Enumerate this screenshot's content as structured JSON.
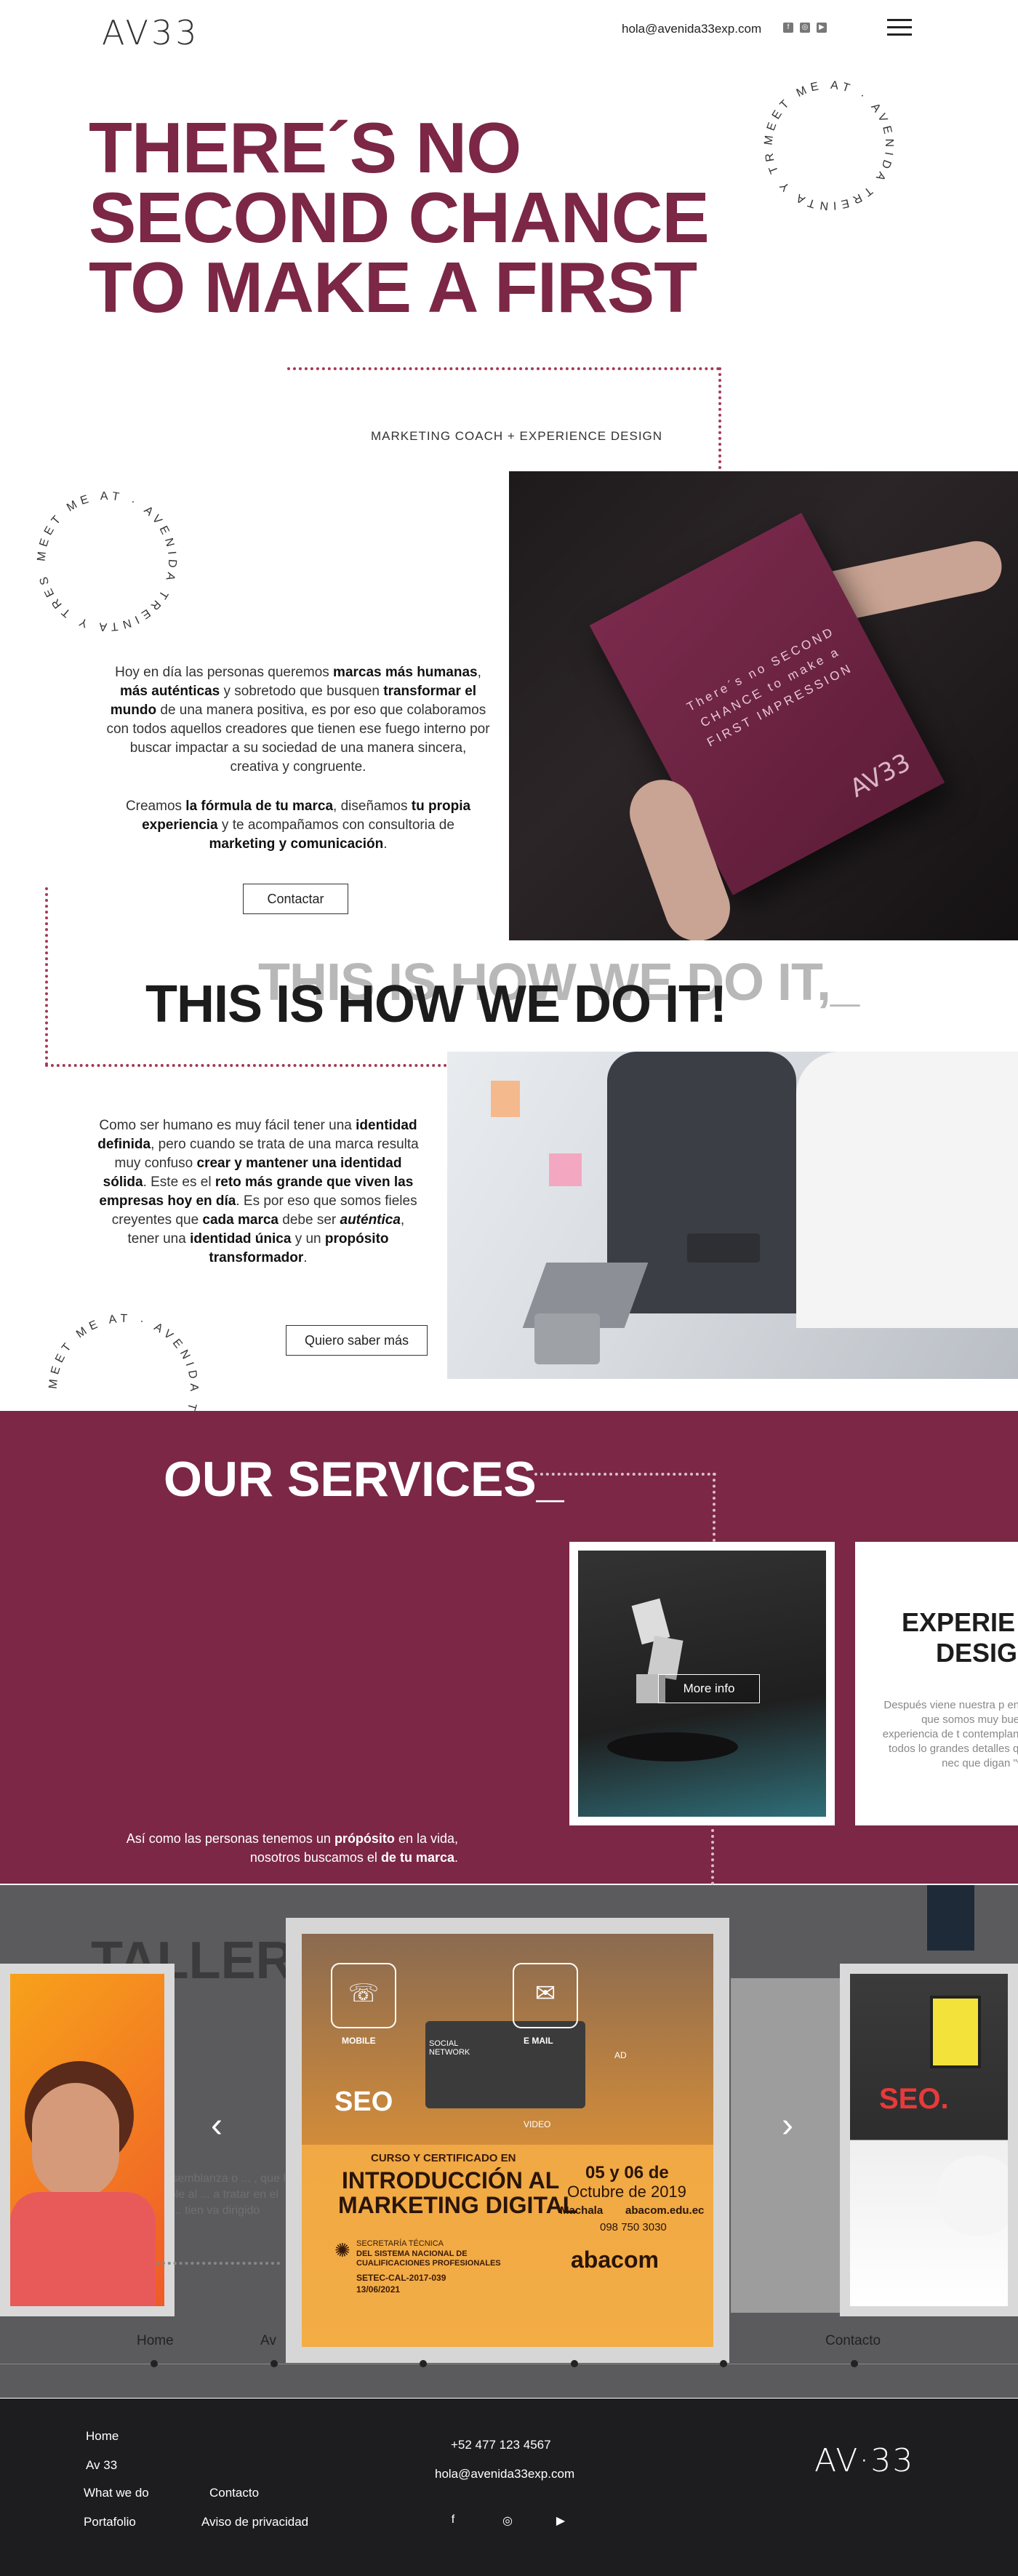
{
  "header": {
    "logo": "AV33",
    "email": "hola@avenida33exp.com",
    "social_icons": [
      "facebook-icon",
      "instagram-icon",
      "youtube-icon"
    ]
  },
  "hero": {
    "title": "THERE´S NO SECOND CHANCE TO MAKE A FIRST",
    "subtitle": "MARKETING COACH + EXPERIENCE DESIGN",
    "ring_text": "MEET ME AT · AVENIDA TREINTA Y TRES ·"
  },
  "about": {
    "ring_text": "MEET ME AT · AVENIDA TREINTA Y TRES ·",
    "para1_a": "Hoy en día las personas queremos ",
    "para1_b": "marcas más humanas",
    "para1_c": ", ",
    "para1_d": "más auténticas",
    "para1_e": " y sobretodo que busquen ",
    "para1_f": "transformar el mundo",
    "para1_g": " de una manera positiva, es por eso que colaboramos con todos aquellos creadores que tienen ese fuego interno por buscar impactar a su sociedad de una manera sincera, creativa y congruente.",
    "para2_a": "Creamos ",
    "para2_b": "la fórmula de tu marca",
    "para2_c": ", diseñamos ",
    "para2_d": "tu propia experiencia",
    "para2_e": " y te acompañamos con consultoria de ",
    "para2_f": "marketing y comunicación",
    "para2_g": ".",
    "button": "Contactar",
    "book_text": "There´s no SECOND CHANCE to make a FIRST IMPRESSION",
    "book_logo": "AV33"
  },
  "how": {
    "shadow_title": "THIS IS HOW WE DO IT,_",
    "title": "THIS IS HOW WE DO IT!",
    "p_a": "Como ser humano es muy fácil tener una ",
    "p_b": "identidad definida",
    "p_c": ", pero cuando se trata de una marca resulta muy confuso ",
    "p_d": "crear y mantener una identidad sólida",
    "p_e": ". Este es el ",
    "p_f": "reto más grande que viven las empresas hoy en día",
    "p_g": ". Es por eso que somos fieles creyentes que ",
    "p_h": "cada marca",
    "p_i": " debe ser ",
    "p_j": "auténtica",
    "p_k": ", tener una ",
    "p_l": "identidad única",
    "p_m": " y un ",
    "p_n": "propósito transformador",
    "p_o": ".",
    "button": "Quiero saber más",
    "ring_text": "MEET ME AT · AVENIDA TREINTA Y TRES ·"
  },
  "services": {
    "title": "OUR SERVICES_",
    "card_button": "More info",
    "card2_title_1": "EXPERIE",
    "card2_title_2": "DESIG",
    "card2_text": "Después viene nuestra p en lo que somos muy bue la experiencia de t contemplando todos lo grandes detalles que nec que digan \"wo",
    "foot_a": "Así como las personas tenemos un ",
    "foot_b": "própósito",
    "foot_c": " en la vida, nosotros buscamos el ",
    "foot_d": "de tu marca",
    "foot_e": "."
  },
  "talleres": {
    "title": "TALLERE",
    "bg_text": "ve semblanza o ... , que le hable al ... a tratar en el pla... tien va dirigido",
    "flyer": {
      "mobile": "MOBILE",
      "email": "E MAIL",
      "social": "SOCIAL NETWORK",
      "ad": "AD",
      "seo": "SEO",
      "video": "VIDEO",
      "course": "CURSO Y CERTIFICADO EN",
      "title1": "INTRODUCCIÓN AL",
      "title2": "MARKETING DIGITAL",
      "date": "05 y 06 de",
      "date2": "Octubre de 2019",
      "city": "Machala",
      "web": "abacom.edu.ec",
      "phone": "098 750 3030",
      "secretaria": "SECRETARÍA TÉCNICA",
      "sistema": "DEL SISTEMA NACIONAL DE CUALIFICACIONES PROFESIONALES",
      "setec": "SETEC-CAL-2017-039",
      "setec_date": "13/06/2021",
      "brand": "abacom"
    },
    "right_sign": "SEO.",
    "nav": [
      "Home",
      "Av",
      "Contacto"
    ]
  },
  "footer": {
    "links": [
      "Home",
      "Av 33",
      "What we do",
      "Portafolio",
      "Contacto",
      "Aviso de privacidad"
    ],
    "phone": "+52 477 123 4567",
    "email": "hola@avenida33exp.com",
    "logo": "AV·33",
    "social_icons": [
      "facebook-icon",
      "instagram-icon",
      "youtube-icon"
    ]
  },
  "colors": {
    "brand": "#7b2745",
    "dark": "#1d1d1f",
    "flyer_orange": "#f0a844"
  }
}
